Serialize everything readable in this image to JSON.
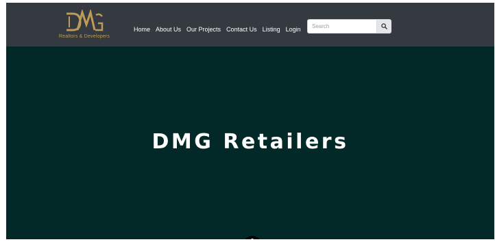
{
  "brand": {
    "logo_text": "DMG",
    "tagline": "Realtors & Developers",
    "gold": "#bf9b58"
  },
  "nav": {
    "items": [
      {
        "label": "Home"
      },
      {
        "label": "About Us"
      },
      {
        "label": "Our Projects"
      },
      {
        "label": "Contact Us"
      },
      {
        "label": "Listing"
      },
      {
        "label": "Login"
      }
    ]
  },
  "search": {
    "placeholder": "Search",
    "button_icon": "search-icon"
  },
  "hero": {
    "title": "DMG Retailers",
    "background": "#022827"
  },
  "scroll_indicator": {
    "icon": "scroll-down-icon"
  },
  "colors": {
    "navbar": "#353a40",
    "hero": "#022827",
    "text": "#ffffff"
  }
}
